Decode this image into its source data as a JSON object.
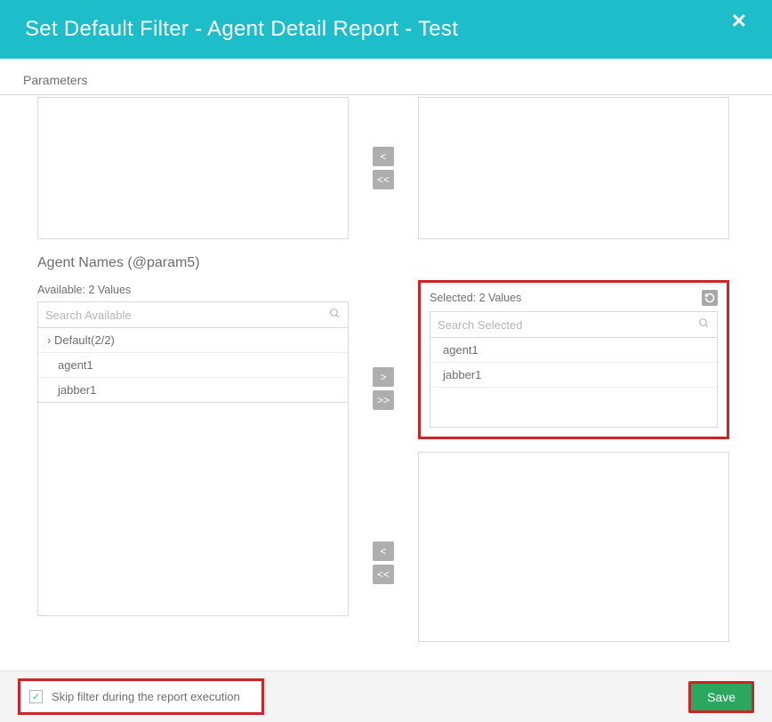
{
  "header": {
    "title": "Set Default Filter - Agent Detail Report - Test",
    "close_icon": "✕"
  },
  "tabs": {
    "parameters": "Parameters"
  },
  "upper_transfer": {
    "move_left": "<",
    "move_all_left": "<<"
  },
  "param5": {
    "label": "Agent Names (@param5)",
    "available": {
      "label": "Available: 2 Values",
      "search_placeholder": "Search Available",
      "group": "Default(2/2)",
      "items": [
        "agent1",
        "jabber1"
      ]
    },
    "buttons": {
      "move_right": ">",
      "move_all_right": ">>",
      "move_left": "<",
      "move_all_left": "<<"
    },
    "selected": {
      "label": "Selected: 2 Values",
      "search_placeholder": "Search Selected",
      "items": [
        "agent1",
        "jabber1"
      ],
      "reset_icon": "↻"
    }
  },
  "footer": {
    "skip_label": "Skip filter during the report execution",
    "skip_checked": true,
    "save_label": "Save"
  }
}
